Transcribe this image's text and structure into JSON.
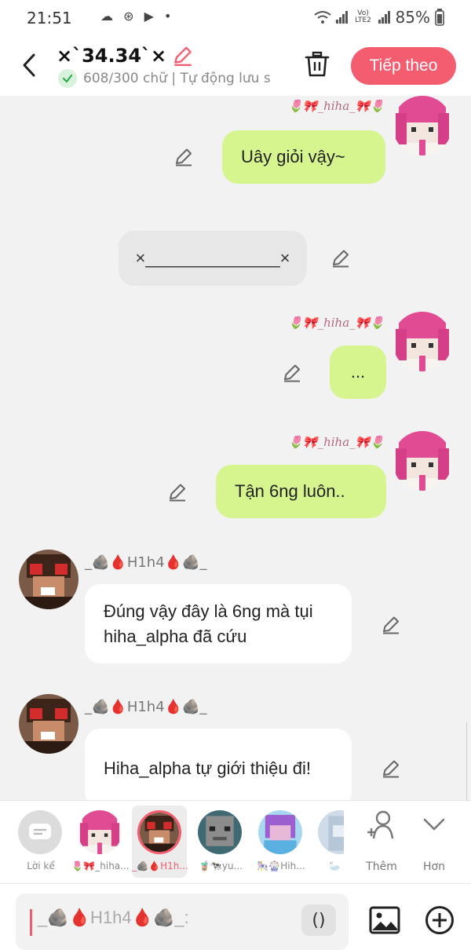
{
  "status_bar": {
    "time": "21:51",
    "left_icons": "☁ ⊛ ▶ •",
    "network": "Vo) LTE2",
    "battery": "85%"
  },
  "header": {
    "title": "×`34.34`×",
    "subtitle": "608/300 chữ | Tự động lưu s",
    "next_label": "Tiếp theo"
  },
  "messages": [
    {
      "side": "right",
      "sender": "🌷🎀_hiha_🎀🌷",
      "text": "Uây giỏi vậy~"
    },
    {
      "side": "center",
      "text": "×______________×"
    },
    {
      "side": "right",
      "sender": "🌷🎀_hiha_🎀🌷",
      "text": "..."
    },
    {
      "side": "right",
      "sender": "🌷🎀_hiha_🎀🌷",
      "text": "Tận 6ng luôn.."
    },
    {
      "side": "left",
      "sender": "_🪨🩸H1h4🩸🪨_",
      "text": "Đúng vậy đây là 6ng mà tụi hiha_alpha đã cứu"
    },
    {
      "side": "left",
      "sender": "_🪨🩸H1h4🩸🪨_",
      "text": "Hiha_alpha tự giới thiệu đi!"
    }
  ],
  "characters": [
    {
      "label": "Lời kể",
      "kind": "narrator"
    },
    {
      "label": "🌷🎀_hiha...",
      "kind": "pink"
    },
    {
      "label": "_🪨🩸H1h...",
      "kind": "brown",
      "selected": true
    },
    {
      "label": "🧋🐄yu...",
      "kind": "gray"
    },
    {
      "label": "🎠🎡Hih...",
      "kind": "purple"
    },
    {
      "label": "🦢❕",
      "kind": "blue"
    }
  ],
  "side_buttons": {
    "add_label": "Thêm",
    "more_label": "Hơn"
  },
  "composer": {
    "placeholder": "_🪨🩸H1h4🩸🪨_:",
    "paren_label": "()"
  },
  "colors": {
    "accent": "#f45d6f",
    "bubble_right": "#d6f58f",
    "bubble_left": "#ffffff",
    "narration": "#e7e7e7"
  }
}
